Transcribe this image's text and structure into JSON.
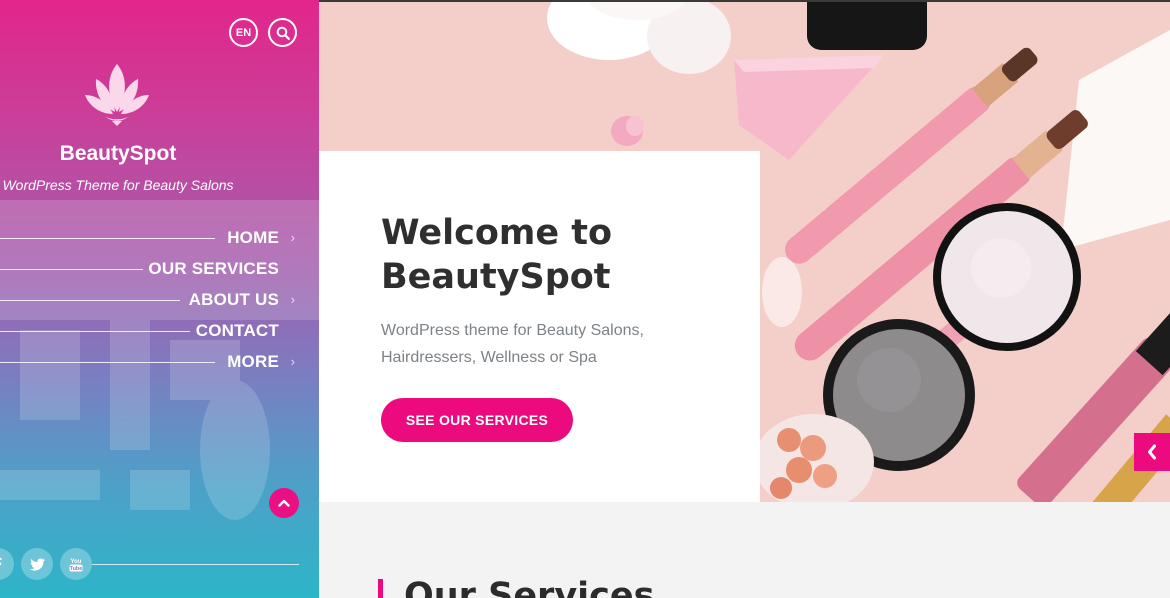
{
  "header": {
    "language": "EN",
    "search_icon": "search-icon"
  },
  "brand": {
    "name": "BeautySpot",
    "tagline": "WordPress Theme for Beauty Salons",
    "logo_icon": "lotus-icon"
  },
  "nav": {
    "items": [
      {
        "label": "HOME",
        "has_submenu": true
      },
      {
        "label": "OUR SERVICES",
        "has_submenu": false
      },
      {
        "label": "ABOUT US",
        "has_submenu": true
      },
      {
        "label": "CONTACT",
        "has_submenu": false
      },
      {
        "label": "MORE",
        "has_submenu": true
      }
    ]
  },
  "social": {
    "icons": [
      "facebook-icon",
      "twitter-icon",
      "youtube-icon"
    ]
  },
  "hero": {
    "title": "Welcome to BeautySpot",
    "subtitle": "WordPress theme for Beauty Salons, Hairdressers, Wellness or Spa",
    "cta_label": "SEE OUR SERVICES"
  },
  "services": {
    "title": "Our Services"
  },
  "colors": {
    "accent": "#ec0b7f",
    "sidebar_top": "#e2258b",
    "sidebar_bottom": "#2db5c8",
    "heading": "#2f2f2f",
    "body_text": "#7d8287"
  }
}
